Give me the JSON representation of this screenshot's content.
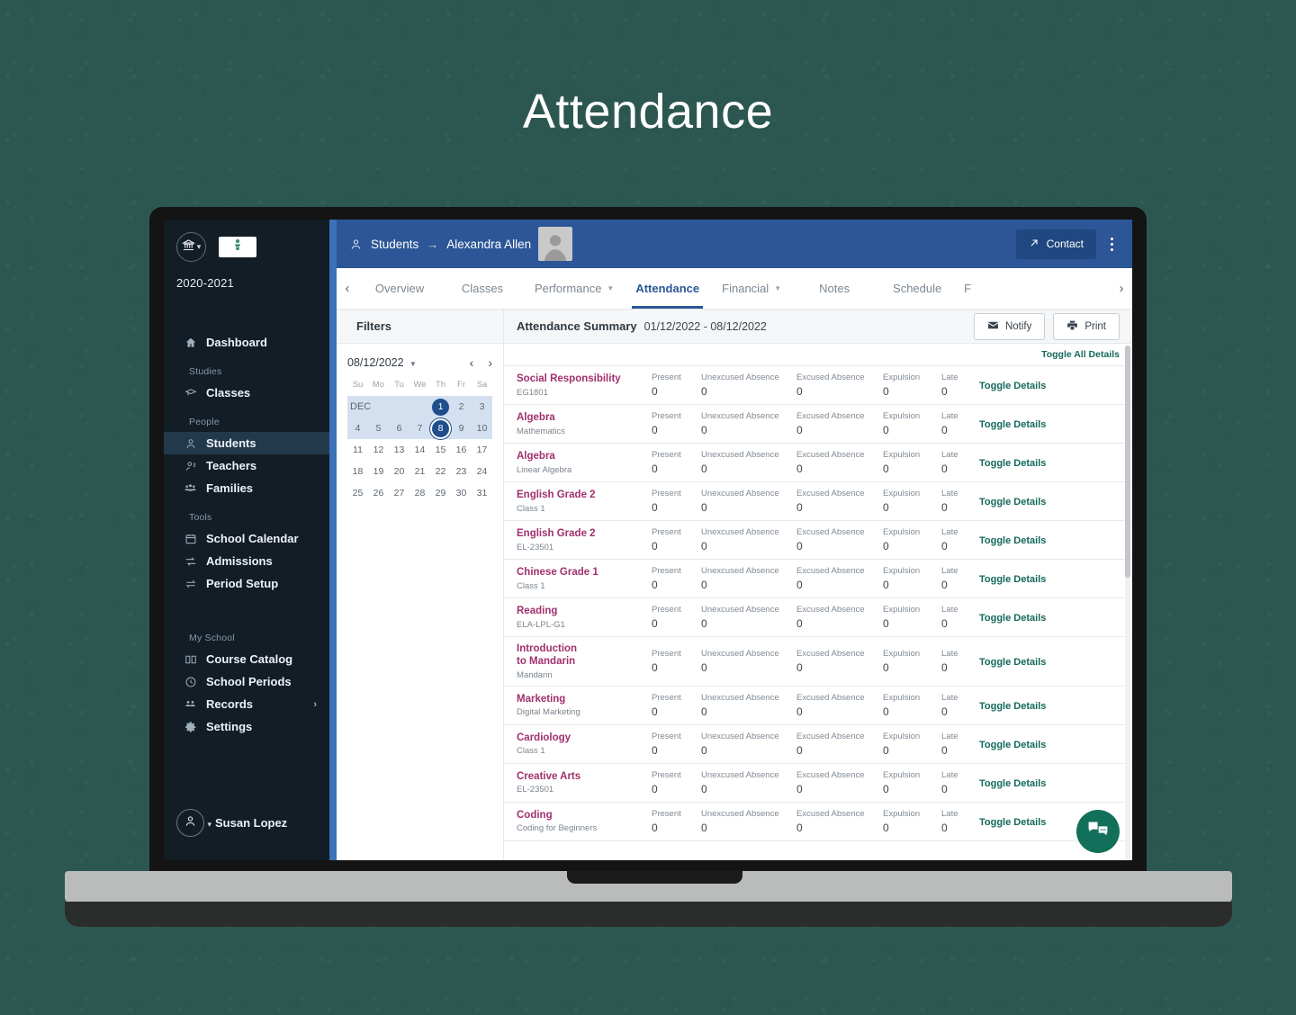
{
  "page": {
    "title": "Attendance",
    "background_color": "#2c5750"
  },
  "sidebar": {
    "school_icon": "bank-icon",
    "logo_icon": "school-logo-icon",
    "year": "2020-2021",
    "dashboard": {
      "label": "Dashboard",
      "icon": "home-icon"
    },
    "groups": [
      {
        "label": "Studies",
        "items": [
          {
            "label": "Classes",
            "icon": "graduation-cap-icon",
            "active": false,
            "caret": false
          }
        ]
      },
      {
        "label": "People",
        "items": [
          {
            "label": "Students",
            "icon": "user-icon",
            "active": true,
            "caret": false
          },
          {
            "label": "Teachers",
            "icon": "teacher-icon",
            "active": false,
            "caret": false
          },
          {
            "label": "Families",
            "icon": "family-icon",
            "active": false,
            "caret": false
          }
        ]
      },
      {
        "label": "Tools",
        "items": [
          {
            "label": "School Calendar",
            "icon": "calendar-icon",
            "active": false,
            "caret": false
          },
          {
            "label": "Admissions",
            "icon": "admissions-icon",
            "active": false,
            "caret": false
          },
          {
            "label": "Period Setup",
            "icon": "swap-icon",
            "active": false,
            "caret": false
          }
        ]
      },
      {
        "label": "My School",
        "items": [
          {
            "label": "Course Catalog",
            "icon": "book-icon",
            "active": false,
            "caret": false
          },
          {
            "label": "School Periods",
            "icon": "clock-icon",
            "active": false,
            "caret": false
          },
          {
            "label": "Records",
            "icon": "records-icon",
            "active": false,
            "caret": true
          },
          {
            "label": "Settings",
            "icon": "gear-icon",
            "active": false,
            "caret": false
          }
        ]
      }
    ],
    "user": {
      "name": "Susan Lopez",
      "avatar_icon": "user-avatar-icon"
    }
  },
  "topbar": {
    "breadcrumb_icon": "student-icon",
    "breadcrumb_root": "Students",
    "breadcrumb_arrow": "→",
    "breadcrumb_current": "Alexandra Allen",
    "contact_label": "Contact",
    "contact_icon": "external-link-icon",
    "more_icon": "kebab-menu-icon",
    "accent_color": "#2c5697"
  },
  "tabs": {
    "prev_icon": "chevron-left-icon",
    "next_icon": "chevron-right-icon",
    "items": [
      {
        "label": "Overview",
        "active": false,
        "caret": false
      },
      {
        "label": "Classes",
        "active": false,
        "caret": false
      },
      {
        "label": "Performance",
        "active": false,
        "caret": true
      },
      {
        "label": "Attendance",
        "active": true,
        "caret": false
      },
      {
        "label": "Financial",
        "active": false,
        "caret": true
      },
      {
        "label": "Notes",
        "active": false,
        "caret": false
      },
      {
        "label": "Schedule",
        "active": false,
        "caret": false
      },
      {
        "label": "F",
        "active": false,
        "caret": false
      }
    ]
  },
  "filters": {
    "title": "Filters",
    "date_value": "08/12/2022",
    "prev_icon": "chevron-left-icon",
    "next_icon": "chevron-right-icon",
    "weekdays": [
      "Su",
      "Mo",
      "Tu",
      "We",
      "Th",
      "Fr",
      "Sa"
    ],
    "month_label": "DEC",
    "weeks": [
      {
        "in_range": true,
        "cells": [
          "DEC",
          "",
          "",
          "",
          "1",
          "2",
          "3"
        ]
      },
      {
        "in_range": true,
        "cells": [
          "4",
          "5",
          "6",
          "7",
          "8",
          "9",
          "10"
        ]
      },
      {
        "in_range": false,
        "cells": [
          "11",
          "12",
          "13",
          "14",
          "15",
          "16",
          "17"
        ]
      },
      {
        "in_range": false,
        "cells": [
          "18",
          "19",
          "20",
          "21",
          "22",
          "23",
          "24"
        ]
      },
      {
        "in_range": false,
        "cells": [
          "25",
          "26",
          "27",
          "28",
          "29",
          "30",
          "31"
        ]
      }
    ],
    "selected_start": "1",
    "selected_end": "8"
  },
  "summary": {
    "title": "Attendance Summary",
    "range": "01/12/2022 - 08/12/2022",
    "notify_label": "Notify",
    "notify_icon": "envelope-icon",
    "print_label": "Print",
    "print_icon": "printer-icon",
    "toggle_all_label": "Toggle All Details",
    "toggle_details_label": "Toggle Details",
    "metric_labels": {
      "present": "Present",
      "unexcused": "Unexcused Absence",
      "excused": "Excused Absence",
      "expulsion": "Expulsion",
      "late": "Late"
    },
    "rows": [
      {
        "course": "Social Responsibility",
        "section": "EG1801",
        "present": "0",
        "unexcused": "0",
        "excused": "0",
        "expulsion": "0",
        "late": "0"
      },
      {
        "course": "Algebra",
        "section": "Mathematics",
        "present": "0",
        "unexcused": "0",
        "excused": "0",
        "expulsion": "0",
        "late": "0"
      },
      {
        "course": "Algebra",
        "section": "Linear Algebra",
        "present": "0",
        "unexcused": "0",
        "excused": "0",
        "expulsion": "0",
        "late": "0"
      },
      {
        "course": "English Grade 2",
        "section": "Class 1",
        "present": "0",
        "unexcused": "0",
        "excused": "0",
        "expulsion": "0",
        "late": "0"
      },
      {
        "course": "English Grade 2",
        "section": "EL-23501",
        "present": "0",
        "unexcused": "0",
        "excused": "0",
        "expulsion": "0",
        "late": "0"
      },
      {
        "course": "Chinese Grade 1",
        "section": "Class 1",
        "present": "0",
        "unexcused": "0",
        "excused": "0",
        "expulsion": "0",
        "late": "0"
      },
      {
        "course": "Reading",
        "section": "ELA-LPL-G1",
        "present": "0",
        "unexcused": "0",
        "excused": "0",
        "expulsion": "0",
        "late": "0"
      },
      {
        "course": "Introduction to Mandarin",
        "section": "Mandarin",
        "present": "0",
        "unexcused": "0",
        "excused": "0",
        "expulsion": "0",
        "late": "0"
      },
      {
        "course": "Marketing",
        "section": "Digital Marketing",
        "present": "0",
        "unexcused": "0",
        "excused": "0",
        "expulsion": "0",
        "late": "0"
      },
      {
        "course": "Cardiology",
        "section": "Class 1",
        "present": "0",
        "unexcused": "0",
        "excused": "0",
        "expulsion": "0",
        "late": "0"
      },
      {
        "course": "Creative Arts",
        "section": "EL-23501",
        "present": "0",
        "unexcused": "0",
        "excused": "0",
        "expulsion": "0",
        "late": "0"
      },
      {
        "course": "Coding",
        "section": "Coding for Beginners",
        "present": "0",
        "unexcused": "0",
        "excused": "0",
        "expulsion": "0",
        "late": "0"
      }
    ]
  },
  "chat": {
    "icon": "chat-bubbles-icon",
    "color": "#12705a"
  }
}
